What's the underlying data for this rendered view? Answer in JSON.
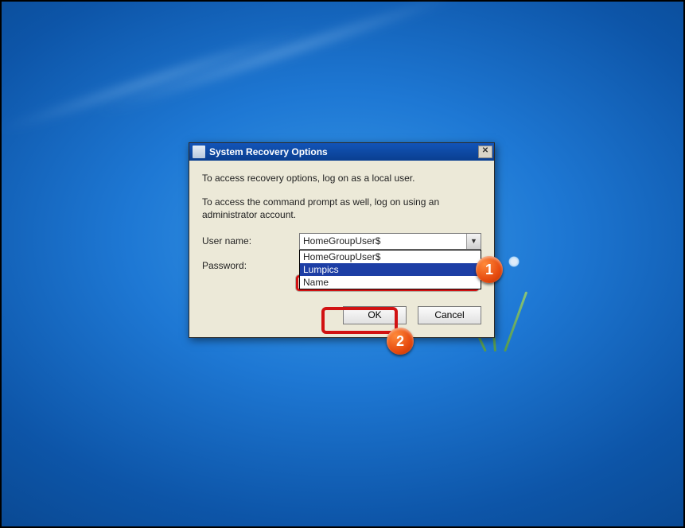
{
  "dialog": {
    "title": "System Recovery Options",
    "msg1": "To access recovery options, log on as a local user.",
    "msg2": "To access the command prompt as well, log on using an administrator account.",
    "username_label": "User name:",
    "password_label": "Password:",
    "username_value": "HomeGroupUser$",
    "dropdown_options": [
      "HomeGroupUser$",
      "Lumpics",
      "Name"
    ],
    "selected_option_index": 1,
    "ok_label": "OK",
    "cancel_label": "Cancel",
    "close_glyph": "✕"
  },
  "annotations": {
    "callout1": "1",
    "callout2": "2"
  }
}
